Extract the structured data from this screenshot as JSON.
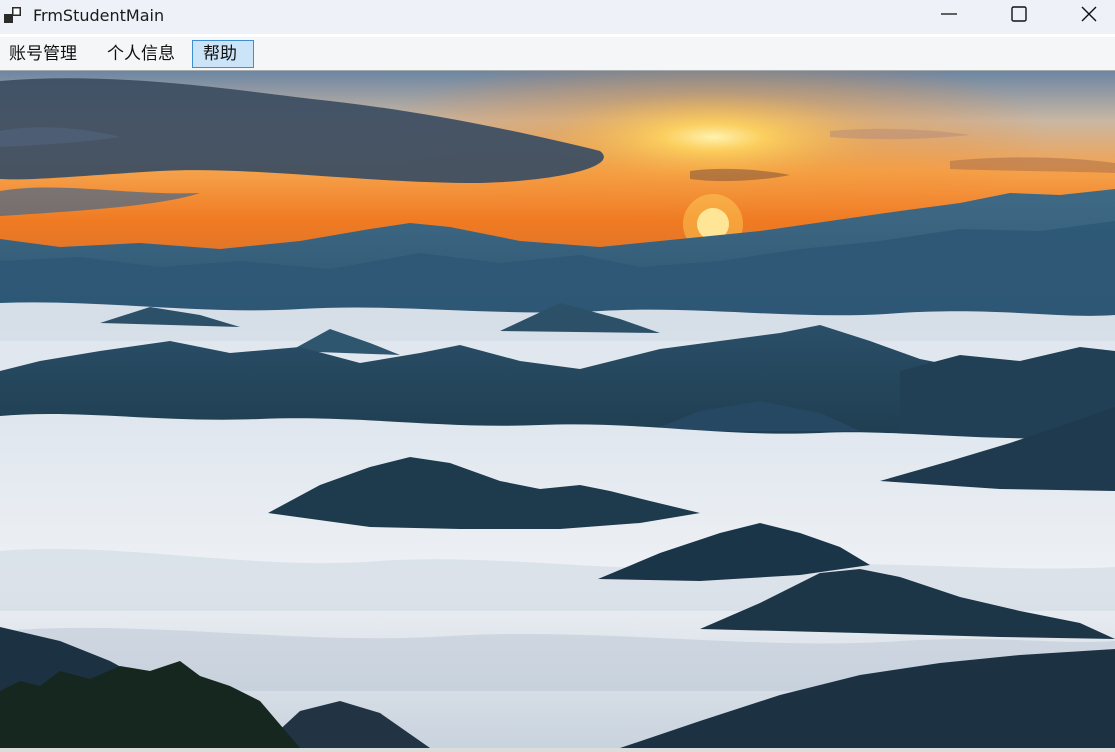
{
  "window": {
    "title": "FrmStudentMain",
    "icons": {
      "app": "app-window-icon",
      "minimize": "minimize-icon",
      "maximize": "maximize-icon",
      "close": "close-icon"
    }
  },
  "menu": {
    "items": [
      {
        "label": "账号管理"
      },
      {
        "label": "个人信息"
      },
      {
        "label": "帮助",
        "highlighted": true
      }
    ]
  },
  "background": {
    "description_icon": "sunrise-sea-of-clouds-image",
    "colors": {
      "sky_top": "#5f7b9a",
      "sun": "#ffd25a",
      "horizon": "#f07a22",
      "mountain_dark": "#1d3a4c",
      "clouds": "#eef1f5"
    }
  }
}
